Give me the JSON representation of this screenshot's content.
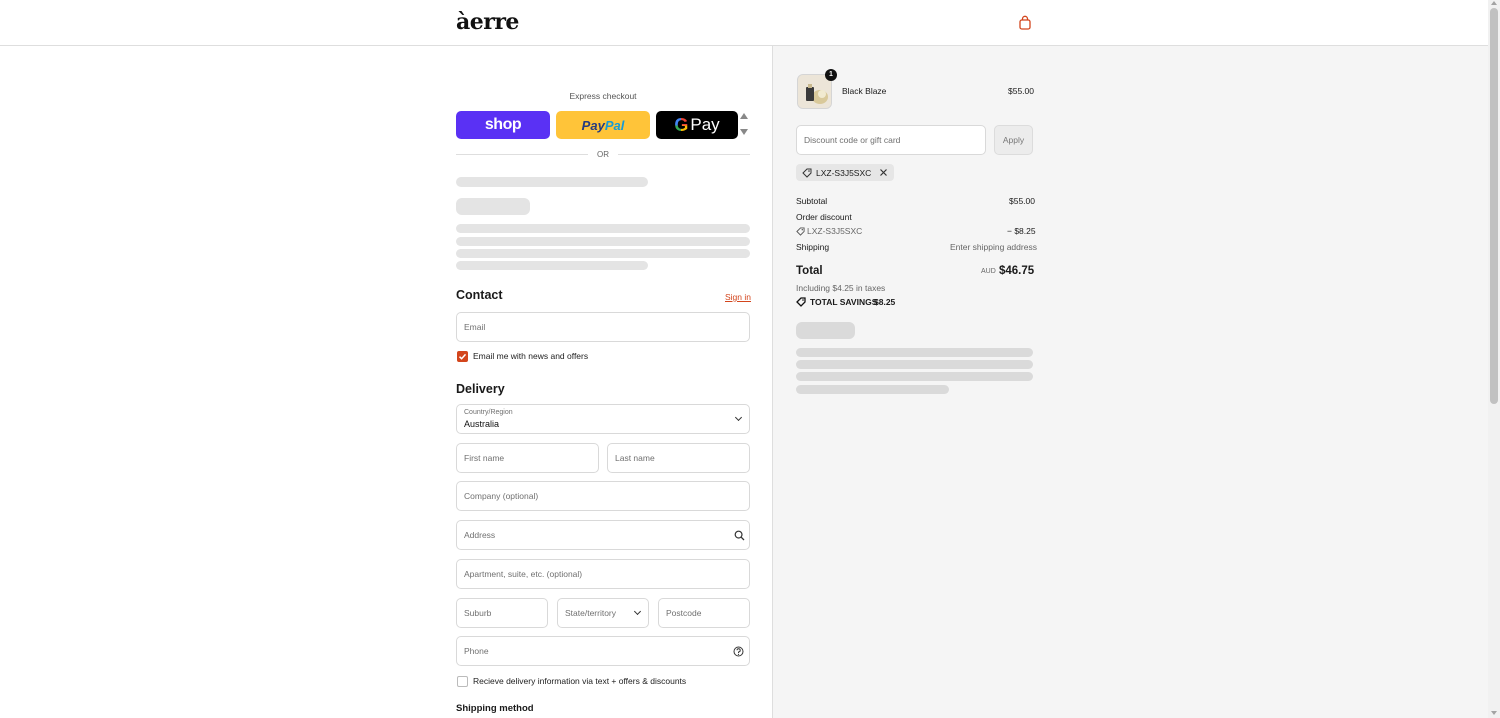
{
  "header": {
    "logo": "àerre"
  },
  "express": {
    "label": "Express checkout",
    "shop_label": "shop",
    "paypal_label": "PayPal",
    "gpay_label": "Pay",
    "or_label": "OR"
  },
  "contact": {
    "title": "Contact",
    "sign_in": "Sign in",
    "email_placeholder": "Email",
    "news_label": "Email me with news and offers",
    "news_checked": true
  },
  "delivery": {
    "title": "Delivery",
    "country_label": "Country/Region",
    "country_value": "Australia",
    "first_name": "First name",
    "last_name": "Last name",
    "company": "Company (optional)",
    "address": "Address",
    "apartment": "Apartment, suite, etc. (optional)",
    "suburb": "Suburb",
    "state": "State/territory",
    "postcode": "Postcode",
    "phone": "Phone",
    "sms_label": "Recieve delivery information via text + offers & discounts",
    "sms_checked": false
  },
  "shipping": {
    "title": "Shipping method"
  },
  "summary": {
    "item": {
      "name": "Black Blaze",
      "price": "$55.00",
      "quantity": "1"
    },
    "discount_placeholder": "Discount code or gift card",
    "apply_label": "Apply",
    "code_chip": "LXZ-S3J5SXC",
    "subtotal_label": "Subtotal",
    "subtotal_value": "$55.00",
    "order_discount_label": "Order discount",
    "discount_code": "LXZ-S3J5SXC",
    "discount_value": "− $8.25",
    "shipping_label": "Shipping",
    "shipping_value": "Enter shipping address",
    "total_label": "Total",
    "currency": "AUD",
    "total_value": "$46.75",
    "taxes_note": "Including $4.25 in taxes",
    "savings_label": "TOTAL SAVINGS",
    "savings_value": "$8.25"
  },
  "colors": {
    "accent": "#d3451c",
    "shop": "#5a31f4",
    "paypal": "#ffc439"
  },
  "icons": [
    "cart-icon",
    "search-icon",
    "help-icon",
    "tag-icon",
    "close-icon",
    "chevron-down-icon"
  ]
}
